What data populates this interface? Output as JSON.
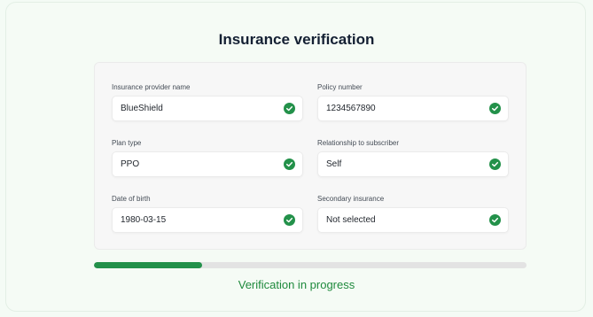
{
  "title": "Insurance verification",
  "fields": [
    {
      "label": "Insurance provider name",
      "value": "BlueShield",
      "status": "verified"
    },
    {
      "label": "Policy number",
      "value": "1234567890",
      "status": "verified"
    },
    {
      "label": "Plan type",
      "value": "PPO",
      "status": "verified"
    },
    {
      "label": "Relationship to subscriber",
      "value": "Self",
      "status": "verified"
    },
    {
      "label": "Date of birth",
      "value": "1980-03-15",
      "status": "verified"
    },
    {
      "label": "Secondary insurance",
      "value": "Not selected",
      "status": "verified"
    }
  ],
  "progress": {
    "fraction": 0.25,
    "status_text": "Verification in progress"
  },
  "icons": {
    "verified": "check-circle-icon"
  },
  "colors": {
    "accent": "#23914a",
    "status_text": "#1f8a3d",
    "background": "#f4fbf5"
  }
}
